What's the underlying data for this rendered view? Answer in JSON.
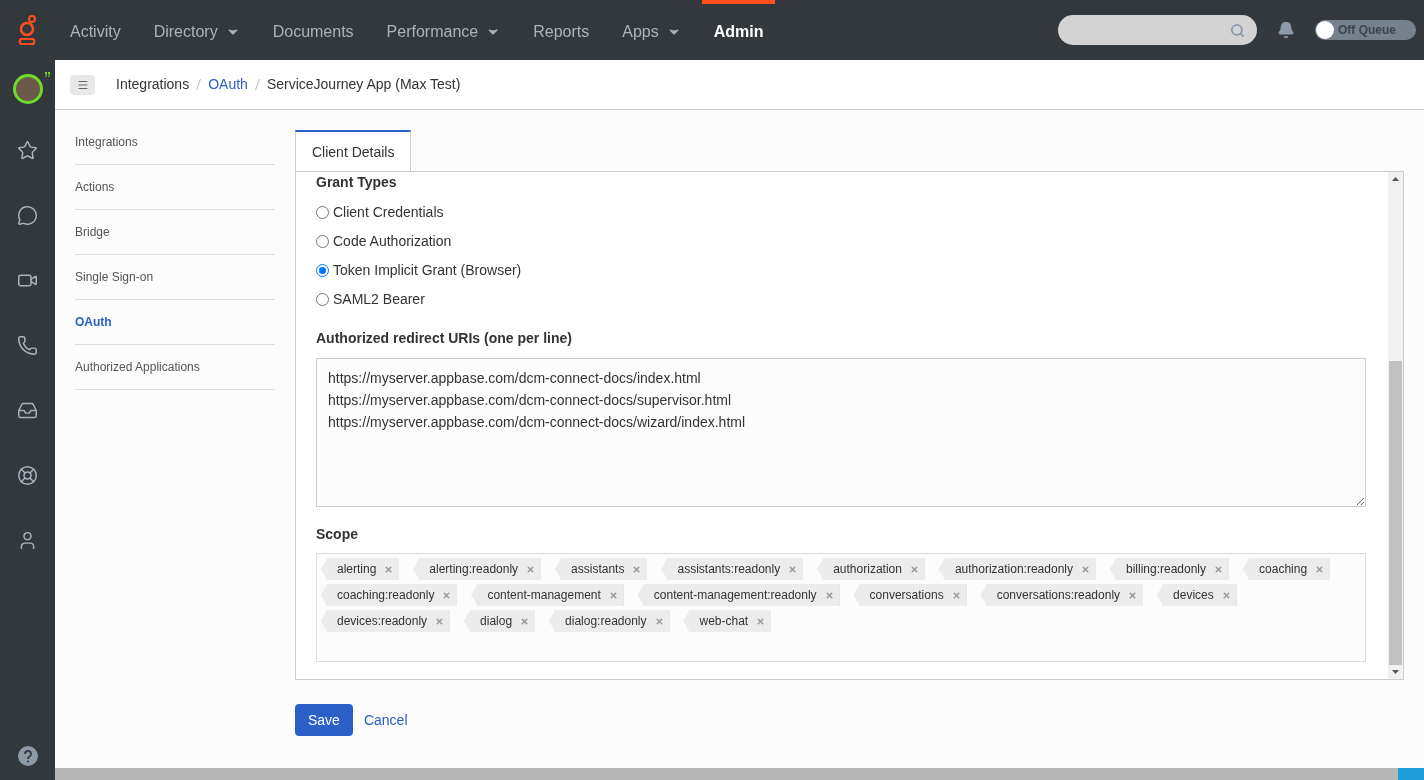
{
  "top_nav": [
    {
      "label": "Activity",
      "dropdown": false,
      "selected": false
    },
    {
      "label": "Directory",
      "dropdown": true,
      "selected": false
    },
    {
      "label": "Documents",
      "dropdown": false,
      "selected": false
    },
    {
      "label": "Performance",
      "dropdown": true,
      "selected": false
    },
    {
      "label": "Reports",
      "dropdown": false,
      "selected": false
    },
    {
      "label": "Apps",
      "dropdown": true,
      "selected": false
    },
    {
      "label": "Admin",
      "dropdown": false,
      "selected": true
    }
  ],
  "queue_toggle": {
    "label": "Off Queue",
    "on": false
  },
  "breadcrumb": [
    {
      "label": "Integrations",
      "link": false
    },
    {
      "label": "OAuth",
      "link": true
    },
    {
      "label": "ServiceJourney App (Max Test)",
      "link": false
    }
  ],
  "side_nav": [
    {
      "label": "Integrations",
      "selected": false
    },
    {
      "label": "Actions",
      "selected": false
    },
    {
      "label": "Bridge",
      "selected": false
    },
    {
      "label": "Single Sign-on",
      "selected": false
    },
    {
      "label": "OAuth",
      "selected": true
    },
    {
      "label": "Authorized Applications",
      "selected": false
    }
  ],
  "tabs": [
    {
      "label": "Client Details",
      "selected": true
    }
  ],
  "grant_types": {
    "heading": "Grant Types",
    "options": [
      {
        "label": "Client Credentials",
        "selected": false
      },
      {
        "label": "Code Authorization",
        "selected": false
      },
      {
        "label": "Token Implicit Grant (Browser)",
        "selected": true
      },
      {
        "label": "SAML2 Bearer",
        "selected": false
      }
    ]
  },
  "redirect_uris": {
    "label": "Authorized redirect URIs (one per line)",
    "value": "https://myserver.appbase.com/dcm-connect-docs/index.html\nhttps://myserver.appbase.com/dcm-connect-docs/supervisor.html\nhttps://myserver.appbase.com/dcm-connect-docs/wizard/index.html"
  },
  "scope": {
    "label": "Scope",
    "tags": [
      "alerting",
      "alerting:readonly",
      "assistants",
      "assistants:readonly",
      "authorization",
      "authorization:readonly",
      "billing:readonly",
      "coaching",
      "coaching:readonly",
      "content-management",
      "content-management:readonly",
      "conversations",
      "conversations:readonly",
      "devices",
      "devices:readonly",
      "dialog",
      "dialog:readonly",
      "web-chat"
    ]
  },
  "buttons": {
    "save": "Save",
    "cancel": "Cancel"
  }
}
